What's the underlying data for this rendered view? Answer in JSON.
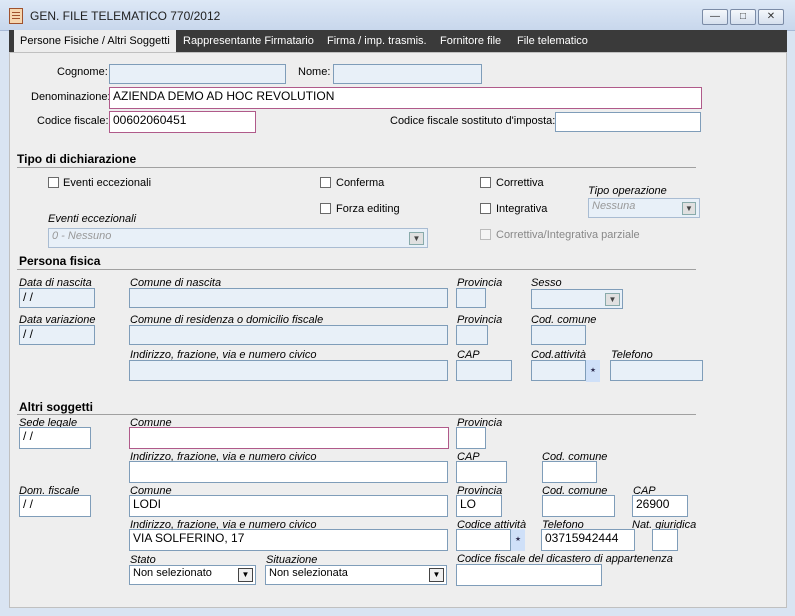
{
  "window": {
    "title": "GEN. FILE TELEMATICO 770/2012"
  },
  "tabs": [
    "Persone Fisiche / Altri Soggetti",
    "Rappresentante Firmatario",
    "Firma / imp. trasmis.",
    "Fornitore file",
    "File telematico"
  ],
  "header": {
    "cognome_label": "Cognome:",
    "cognome": "",
    "nome_label": "Nome:",
    "nome": "",
    "denominazione_label": "Denominazione:",
    "denominazione": "AZIENDA DEMO AD HOC REVOLUTION",
    "codice_fiscale_label": "Codice fiscale:",
    "codice_fiscale": "00602060451",
    "cf_sostituto_label": "Codice fiscale sostituto d'imposta:",
    "cf_sostituto": ""
  },
  "tipo": {
    "section_title": "Tipo di dichiarazione",
    "eventi_eccezionali_cb": "Eventi eccezionali",
    "conferma": "Conferma",
    "forza_editing": "Forza editing",
    "correttiva": "Correttiva",
    "integrativa": "Integrativa",
    "correttiva_parziale": "Correttiva/Integrativa parziale",
    "tipo_operazione_label": "Tipo operazione",
    "tipo_operazione_value": "Nessuna",
    "eventi_label": "Eventi eccezionali",
    "eventi_value": "0 - Nessuno"
  },
  "persona": {
    "section_title": "Persona fisica",
    "data_nascita_label": "Data di nascita",
    "data_nascita": " /  /",
    "comune_nascita_label": "Comune di nascita",
    "provincia_label": "Provincia",
    "sesso_label": "Sesso",
    "data_variazione_label": "Data variazione",
    "data_variazione": " /  /",
    "comune_residenza_label": "Comune di residenza o domicilio fiscale",
    "provincia2_label": "Provincia",
    "cod_comune_label": "Cod. comune",
    "indirizzo_label": "Indirizzo, frazione, via e numero civico",
    "cap_label": "CAP",
    "cod_attivita_label": "Cod.attività",
    "telefono_label": "Telefono"
  },
  "altri": {
    "section_title": "Altri soggetti",
    "sede_legale_label": "Sede legale",
    "sede_legale": " /  /",
    "comune_label": "Comune",
    "provincia_label": "Provincia",
    "indirizzo_label": "Indirizzo, frazione, via e numero civico",
    "cap_label": "CAP",
    "cod_comune_label": "Cod. comune",
    "dom_fiscale_label": "Dom. fiscale",
    "dom_fiscale": " /  /",
    "comune2_label": "Comune",
    "comune2": "LODI",
    "provincia2_label": "Provincia",
    "provincia2": "LO",
    "cod_comune2_label": "Cod. comune",
    "cap2_label": "CAP",
    "cap2": "26900",
    "indirizzo2_label": "Indirizzo, frazione, via e numero civico",
    "indirizzo2": "VIA SOLFERINO, 17",
    "codice_attivita_label": "Codice attività",
    "telefono_label": "Telefono",
    "telefono": "03715942444",
    "nat_giuridica_label": "Nat. giuridica",
    "stato_label": "Stato",
    "stato": "Non selezionato",
    "situazione_label": "Situazione",
    "situazione": "Non selezionata",
    "cf_dicastero_label": "Codice fiscale del dicastero di appartenenza"
  }
}
